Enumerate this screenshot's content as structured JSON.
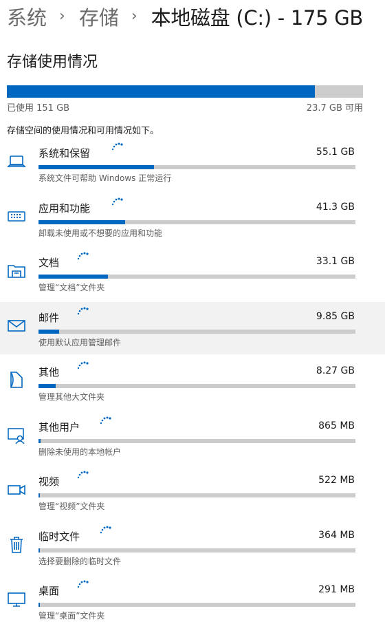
{
  "breadcrumb": {
    "items": [
      "系统",
      "存储"
    ],
    "current": "本地磁盘 (C:) - 175 GB"
  },
  "usage": {
    "title": "存储使用情况",
    "used_label": "已使用 151 GB",
    "free_label": "23.7 GB 可用",
    "used_fraction": 0.864,
    "description": "存储空间的使用情况和可用情况如下。"
  },
  "colors": {
    "accent": "#0067c0",
    "bar_track": "#cccccc"
  },
  "categories": [
    {
      "name": "系统和保留",
      "size": "55.1 GB",
      "desc": "系统文件可帮助 Windows 正常运行",
      "fraction": 0.364,
      "icon": "laptop-icon"
    },
    {
      "name": "应用和功能",
      "size": "41.3 GB",
      "desc": "卸载未使用或不想要的应用和功能",
      "fraction": 0.273,
      "icon": "keyboard-icon"
    },
    {
      "name": "文档",
      "size": "33.1 GB",
      "desc": "管理“文档”文件夹",
      "fraction": 0.219,
      "icon": "documents-folder-icon"
    },
    {
      "name": "邮件",
      "size": "9.85 GB",
      "desc": "使用默认应用管理邮件",
      "fraction": 0.065,
      "icon": "mail-icon"
    },
    {
      "name": "其他",
      "size": "8.27 GB",
      "desc": "管理其他大文件夹",
      "fraction": 0.055,
      "icon": "other-files-icon"
    },
    {
      "name": "其他用户",
      "size": "865 MB",
      "desc": "删除未使用的本地帐户",
      "fraction": 0.006,
      "icon": "other-users-icon"
    },
    {
      "name": "视频",
      "size": "522 MB",
      "desc": "管理“视频”文件夹",
      "fraction": 0.004,
      "icon": "video-camera-icon"
    },
    {
      "name": "临时文件",
      "size": "364 MB",
      "desc": "选择要删除的临时文件",
      "fraction": 0.003,
      "icon": "trash-icon"
    },
    {
      "name": "桌面",
      "size": "291 MB",
      "desc": "管理“桌面”文件夹",
      "fraction": 0.002,
      "icon": "desktop-monitor-icon"
    }
  ]
}
